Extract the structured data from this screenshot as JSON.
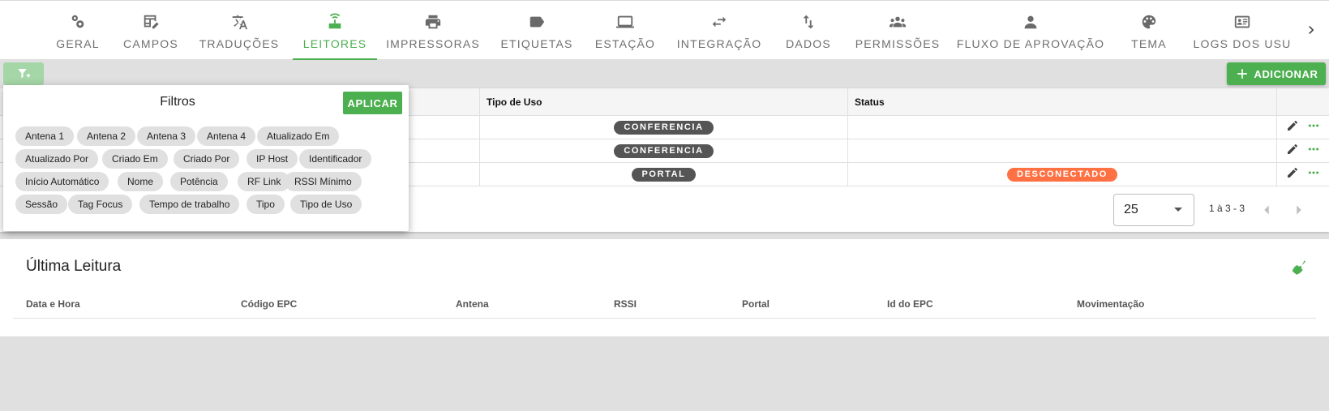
{
  "nav": {
    "tabs": [
      {
        "label": "GERAL",
        "icon": "gears-icon"
      },
      {
        "label": "CAMPOS",
        "icon": "table-edit-icon"
      },
      {
        "label": "TRADUÇÕES",
        "icon": "translate-icon"
      },
      {
        "label": "LEITORES",
        "icon": "router-icon",
        "active": true
      },
      {
        "label": "IMPRESSORAS",
        "icon": "printer-icon"
      },
      {
        "label": "ETIQUETAS",
        "icon": "label-icon"
      },
      {
        "label": "ESTAÇÃO",
        "icon": "laptop-icon"
      },
      {
        "label": "INTEGRAÇÃO",
        "icon": "swap-arrows-icon"
      },
      {
        "label": "DADOS",
        "icon": "swap-vertical-icon"
      },
      {
        "label": "PERMISSÕES",
        "icon": "group-icon"
      },
      {
        "label": "FLUXO DE APROVAÇÃO",
        "icon": "person-icon"
      },
      {
        "label": "TEMA",
        "icon": "palette-icon"
      },
      {
        "label": "LOGS DOS USU",
        "icon": "id-card-icon"
      }
    ],
    "next_icon": "chevron-right-icon"
  },
  "toolbar": {
    "filter_icon": "filter-plus-icon",
    "add_label": "ADICIONAR",
    "add_icon": "plus-icon"
  },
  "table": {
    "columns": [
      "Tipo de Uso",
      "Status"
    ],
    "rows": [
      {
        "tipo_de_uso": "CONFERENCIA",
        "status": ""
      },
      {
        "tipo_de_uso": "CONFERENCIA",
        "status": ""
      },
      {
        "tipo_de_uso": "PORTAL",
        "status": "DESCONECTADO"
      }
    ],
    "row_actions": [
      "pencil-icon",
      "more-horizontal-icon"
    ],
    "per_page": "25",
    "range": "1 à 3 - 3"
  },
  "filters": {
    "title": "Filtros",
    "apply_label": "APLICAR",
    "chips": [
      "Antena 1",
      "Antena 2",
      "Antena 3",
      "Antena 4",
      "Atualizado Em",
      "Atualizado Por",
      "Criado Em",
      "Criado Por",
      "IP Host",
      "Identificador",
      "Início Automático",
      "Nome",
      "Potência",
      "RF Link",
      "RSSI Mínimo",
      "Sessão",
      "Tag Focus",
      "Tempo de trabalho",
      "Tipo",
      "Tipo de Uso"
    ]
  },
  "last_reading": {
    "title": "Última Leitura",
    "clear_icon": "broom-icon",
    "columns": [
      "Data e Hora",
      "Código EPC",
      "Antena",
      "RSSI",
      "Portal",
      "Id do EPC",
      "Movimentação"
    ]
  },
  "colors": {
    "accent": "#4caf50",
    "status_disconnected": "#ff7043",
    "chip_dark": "#555555"
  }
}
